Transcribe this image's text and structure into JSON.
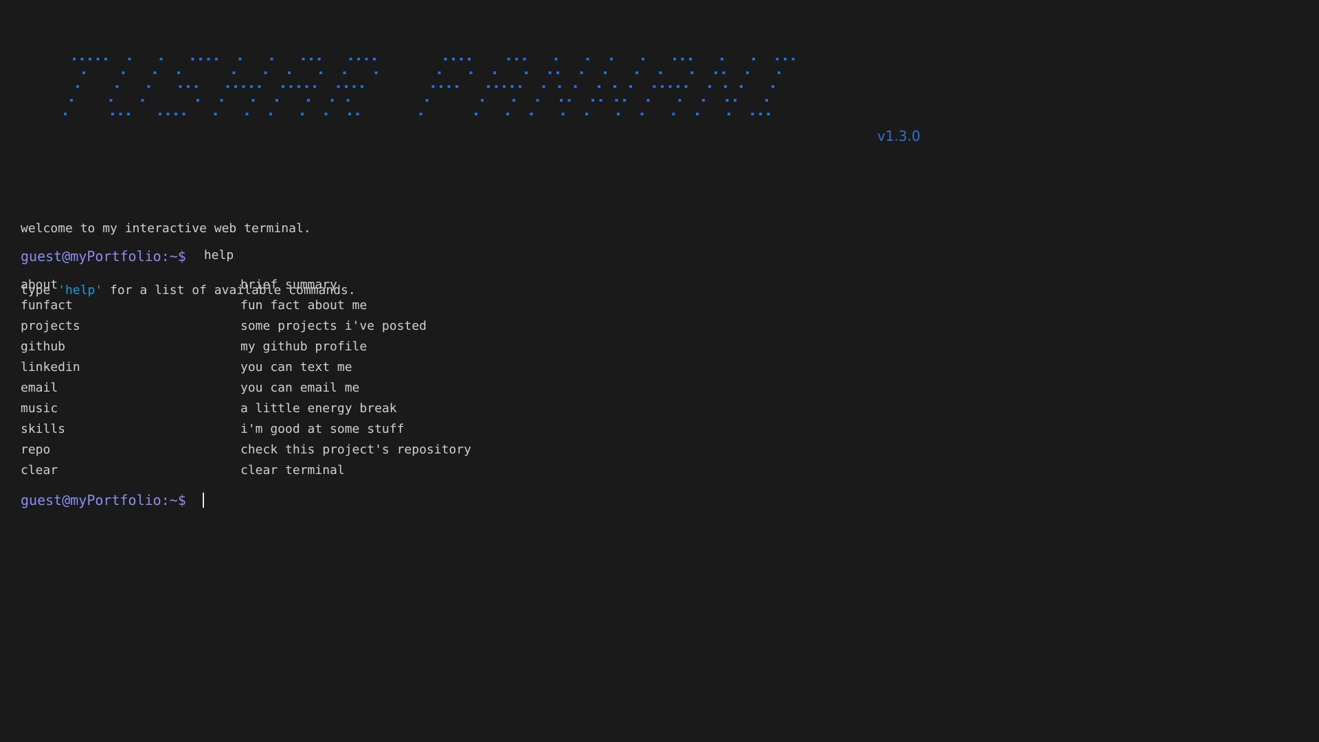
{
  "banner": {
    "text": "TUSHAR PANWANI",
    "color": "#1e6fd9"
  },
  "version": "v1.3.0",
  "welcome": {
    "line1": "welcome to my interactive web terminal.",
    "line2_prefix": "type ",
    "line2_highlight": "'help'",
    "line2_suffix": " for a list of available commands."
  },
  "prompt": "guest@myPortfolio:~$",
  "history": {
    "command": "help"
  },
  "help_items": [
    {
      "cmd": "about",
      "desc": "brief summary"
    },
    {
      "cmd": "funfact",
      "desc": "fun fact about me"
    },
    {
      "cmd": "projects",
      "desc": "some projects i've posted"
    },
    {
      "cmd": "github",
      "desc": "my github profile"
    },
    {
      "cmd": "linkedin",
      "desc": "you can text me"
    },
    {
      "cmd": "email",
      "desc": "you can email me"
    },
    {
      "cmd": "music",
      "desc": "a little energy break"
    },
    {
      "cmd": "skills",
      "desc": "i'm good at some stuff"
    },
    {
      "cmd": "repo",
      "desc": "check this project's repository"
    },
    {
      "cmd": "clear",
      "desc": "clear terminal"
    }
  ],
  "colors": {
    "background": "#1a1a1a",
    "prompt": "#8c8cf2",
    "highlight": "#1a9bd7",
    "version": "#2f6fd6",
    "text": "#cfcfcf"
  }
}
